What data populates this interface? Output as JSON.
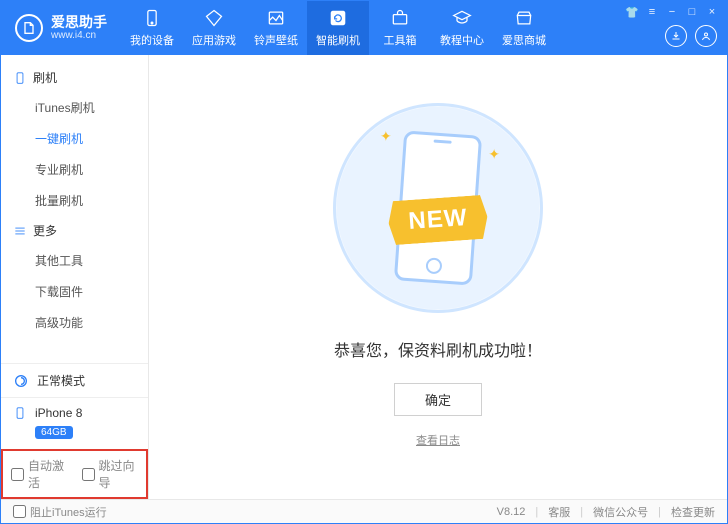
{
  "brand": {
    "name": "爱思助手",
    "url": "www.i4.cn"
  },
  "header": {
    "tabs": [
      {
        "label": "我的设备"
      },
      {
        "label": "应用游戏"
      },
      {
        "label": "铃声壁纸"
      },
      {
        "label": "智能刷机"
      },
      {
        "label": "工具箱"
      },
      {
        "label": "教程中心"
      },
      {
        "label": "爱思商城"
      }
    ],
    "activeTab": 3
  },
  "sidebar": {
    "groups": [
      {
        "title": "刷机",
        "items": [
          "iTunes刷机",
          "一键刷机",
          "专业刷机",
          "批量刷机"
        ],
        "active": 1
      },
      {
        "title": "更多",
        "items": [
          "其他工具",
          "下载固件",
          "高级功能"
        ],
        "active": -1
      }
    ],
    "mode": "正常模式",
    "device": {
      "name": "iPhone 8",
      "capacity": "64GB"
    },
    "options": {
      "autoActivate": "自动激活",
      "skipGuide": "跳过向导"
    }
  },
  "main": {
    "ribbon": "NEW",
    "successText": "恭喜您，保资料刷机成功啦！",
    "okButton": "确定",
    "logLink": "查看日志"
  },
  "footer": {
    "blockItunes": "阻止iTunes运行",
    "version": "V8.12",
    "support": "客服",
    "wechat": "微信公众号",
    "update": "检查更新"
  }
}
